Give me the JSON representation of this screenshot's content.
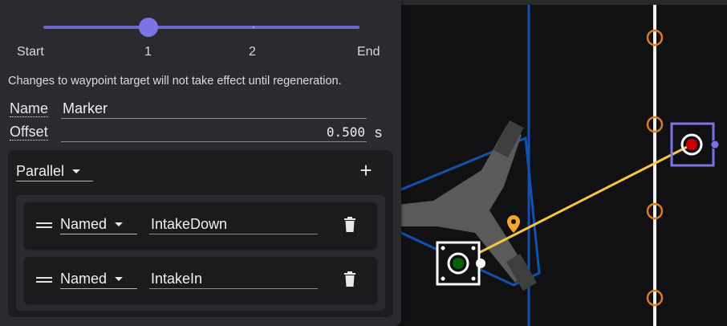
{
  "timeline": {
    "labels": [
      "Start",
      "1",
      "2",
      "End"
    ],
    "value": 1,
    "min": 0,
    "max": 3
  },
  "warning_text": "Changes to waypoint target will not take effect until regeneration.",
  "marker": {
    "name_label": "Name",
    "name_value": "Marker",
    "offset_label": "Offset",
    "offset_value": "0.500",
    "offset_unit": "s"
  },
  "group": {
    "type": "Parallel",
    "add_icon": "plus-icon",
    "commands": [
      {
        "type": "Named",
        "name": "IntakeDown",
        "handle_icon": "drag-handle-icon",
        "delete_icon": "trash-icon"
      },
      {
        "type": "Named",
        "name": "IntakeIn",
        "handle_icon": "drag-handle-icon",
        "delete_icon": "trash-icon"
      }
    ]
  },
  "colors": {
    "accent": "#7c74e4",
    "field_background": "#111113",
    "robot_bumper": "#0d47a1",
    "path_line": "#f7c542",
    "event_marker": "#f7a82a",
    "waypoint_orange": "#e07a1f",
    "selected_waypoint_box": "#7c74e4",
    "waypoint_red": "#cc0000",
    "waypoint_green": "#006400"
  }
}
